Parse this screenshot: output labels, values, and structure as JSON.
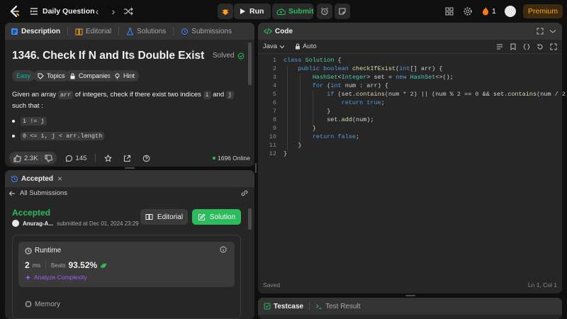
{
  "topbar": {
    "daily_label": "Daily Question",
    "run_label": "Run",
    "submit_label": "Submit",
    "streak_count": "1",
    "premium_label": "Premium"
  },
  "problem_tabs": [
    "Description",
    "Editorial",
    "Solutions",
    "Submissions"
  ],
  "problem": {
    "title": "1346. Check If N and Its Double Exist",
    "status": "Solved",
    "difficulty": "Easy",
    "tags": [
      "Topics",
      "Companies",
      "Hint"
    ],
    "desc_part1": "Given an array ",
    "desc_code1": "arr",
    "desc_part2": " of integers, check if there exist two indices ",
    "desc_code2": "i",
    "desc_part3": " and ",
    "desc_code3": "j",
    "desc_part4": " such that :",
    "bullets": [
      "i != j",
      "0 <= i, j < arr.length"
    ],
    "likes": "2.3K",
    "comments": "145",
    "online": "1696 Online"
  },
  "submission": {
    "tab_label": "Accepted",
    "back_label": "All Submissions",
    "status": "Accepted",
    "user": "Anurag-A...",
    "submitted_at": "submitted at Dec 01, 2024 23:29",
    "editorial_label": "Editorial",
    "solution_label": "Solution",
    "runtime_label": "Runtime",
    "runtime_value": "2",
    "runtime_unit": "ms",
    "beats_label": "Beats",
    "beats_value": "93.52%",
    "analyze_label": "Analyze Complexity",
    "memory_label": "Memory"
  },
  "editor": {
    "tab_label": "Code",
    "language": "Java",
    "auto_label": "Auto",
    "saved_label": "Saved",
    "cursor_pos": "Ln 1, Col 1",
    "line_numbers": [
      "1",
      "2",
      "3",
      "4",
      "5",
      "6",
      "7",
      "8",
      "9",
      "10",
      "11",
      "12"
    ]
  },
  "bottom": {
    "testcase_label": "Testcase",
    "result_label": "Test Result"
  },
  "colors": {
    "accent_green": "#2cbb5d",
    "accent_orange": "#ffa116",
    "panel_bg": "#262626",
    "app_bg": "#0f0f0f"
  }
}
